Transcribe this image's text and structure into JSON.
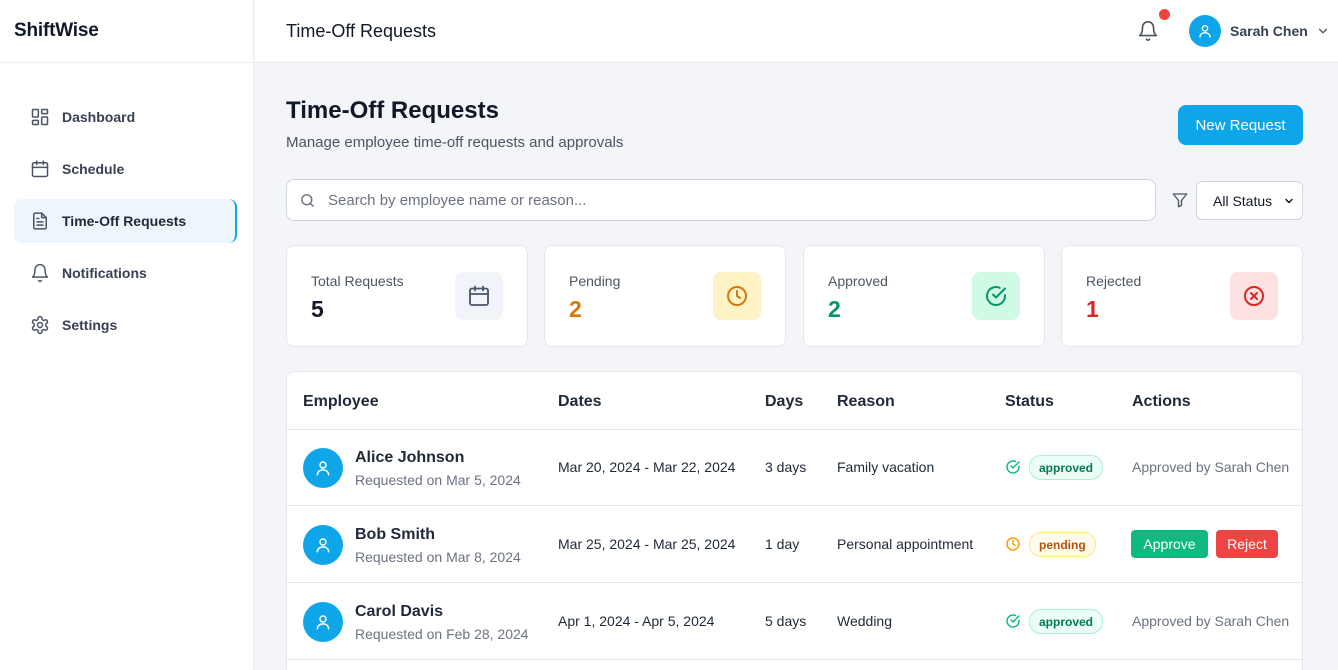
{
  "app": {
    "brand": "ShiftWise"
  },
  "sidebar": {
    "items": [
      {
        "label": "Dashboard",
        "icon": "dashboard-icon",
        "active": false
      },
      {
        "label": "Schedule",
        "icon": "calendar-icon",
        "active": false
      },
      {
        "label": "Time-Off Requests",
        "icon": "document-icon",
        "active": true
      },
      {
        "label": "Notifications",
        "icon": "bell-icon",
        "active": false
      },
      {
        "label": "Settings",
        "icon": "gear-icon",
        "active": false
      }
    ]
  },
  "header": {
    "title": "Time-Off Requests",
    "user_name": "Sarah Chen",
    "has_unread_notifications": true
  },
  "main": {
    "title": "Time-Off Requests",
    "subtitle": "Manage employee time-off requests and approvals",
    "new_request_label": "New Request",
    "search_placeholder": "Search by employee name or reason...",
    "status_filter": {
      "selected": "All Status"
    }
  },
  "stats": [
    {
      "label": "Total Requests",
      "value": "5",
      "icon": "calendar-icon",
      "color": "#111827",
      "icon_bg": "#f1f5f9",
      "icon_color": "#475569"
    },
    {
      "label": "Pending",
      "value": "2",
      "icon": "clock-icon",
      "color": "#d97706",
      "icon_bg": "#fef3c7",
      "icon_color": "#d97706"
    },
    {
      "label": "Approved",
      "value": "2",
      "icon": "check-circle-icon",
      "color": "#059669",
      "icon_bg": "#d1fae5",
      "icon_color": "#059669"
    },
    {
      "label": "Rejected",
      "value": "1",
      "icon": "x-circle-icon",
      "color": "#dc2626",
      "icon_bg": "#fee2e2",
      "icon_color": "#dc2626"
    }
  ],
  "table": {
    "columns": [
      "Employee",
      "Dates",
      "Days",
      "Reason",
      "Status",
      "Actions"
    ],
    "rows": [
      {
        "name": "Alice Johnson",
        "requested": "Requested on Mar 5, 2024",
        "dates": "Mar 20, 2024 - Mar 22, 2024",
        "days": "3 days",
        "reason": "Family vacation",
        "status": "approved",
        "action_text": "Approved by Sarah Chen"
      },
      {
        "name": "Bob Smith",
        "requested": "Requested on Mar 8, 2024",
        "dates": "Mar 25, 2024 - Mar 25, 2024",
        "days": "1 day",
        "reason": "Personal appointment",
        "status": "pending",
        "approve_label": "Approve",
        "reject_label": "Reject"
      },
      {
        "name": "Carol Davis",
        "requested": "Requested on Feb 28, 2024",
        "dates": "Apr 1, 2024 - Apr 5, 2024",
        "days": "5 days",
        "reason": "Wedding",
        "status": "approved",
        "action_text": "Approved by Sarah Chen"
      }
    ]
  },
  "colors": {
    "accent": "#0ea5e9",
    "approve": "#10b981",
    "reject": "#ef4444",
    "notification_dot": "#ef4444"
  }
}
